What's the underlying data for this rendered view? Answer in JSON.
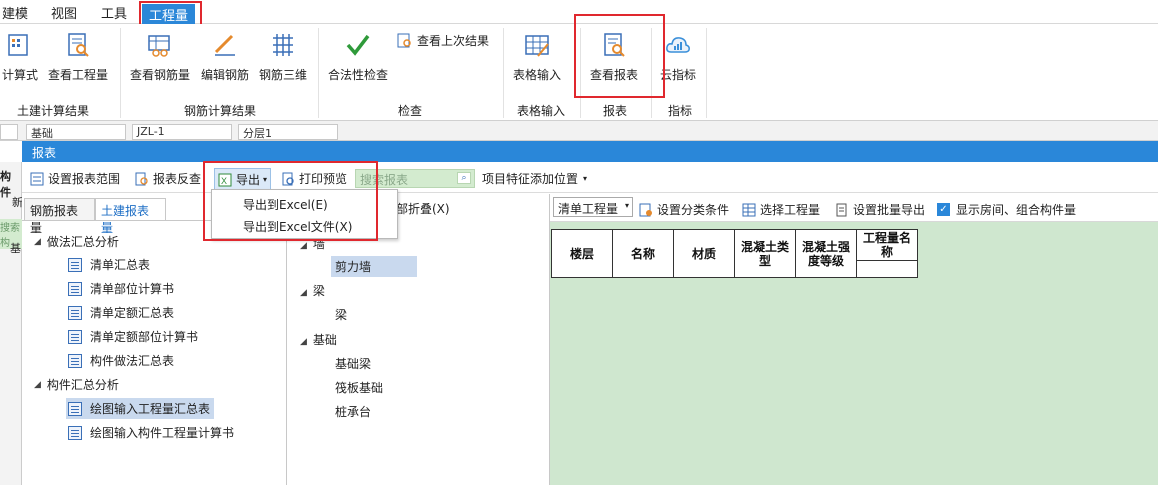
{
  "menubar": {
    "items": [
      "建模",
      "视图",
      "工具",
      "工程量"
    ]
  },
  "ribbon": {
    "buttons": [
      "计算式",
      "查看工程量",
      "查看钢筋量",
      "编辑钢筋",
      "钢筋三维",
      "合法性检查",
      "查看上次结果",
      "表格输入",
      "查看报表",
      "云指标"
    ],
    "groups": [
      "土建计算结果",
      "钢筋计算结果",
      "检查",
      "表格输入",
      "报表",
      "指标"
    ]
  },
  "combos": [
    "基础",
    "JZL-1",
    "分层1"
  ],
  "dialog": {
    "title": "报表",
    "toolbar": {
      "set_range": "设置报表范围",
      "reverse": "报表反查",
      "export": "导出",
      "print_preview": "打印预览",
      "search_placeholder": "搜索报表",
      "feature_position": "项目特征添加位置"
    },
    "export_menu": [
      "导出到Excel(E)",
      "导出到Excel文件(X)"
    ],
    "left_tabs": [
      "钢筋报表量",
      "土建报表量"
    ],
    "tree": {
      "group1": "做法汇总分析",
      "group1_items": [
        "清单汇总表",
        "清单部位计算书",
        "清单定额汇总表",
        "清单定额部位计算书",
        "构件做法汇总表"
      ],
      "group2": "构件汇总分析",
      "group2_items": [
        "绘图输入工程量汇总表",
        "绘图输入构件工程量计算书"
      ]
    },
    "middle": {
      "collapse_all": "部折叠(X)",
      "categories": [
        {
          "name": "墙",
          "items": [
            "剪力墙"
          ]
        },
        {
          "name": "梁",
          "items": [
            "梁"
          ]
        },
        {
          "name": "基础",
          "items": [
            "基础梁",
            "筏板基础",
            "桩承台"
          ]
        }
      ]
    },
    "right_toolbar": {
      "select": "清单工程量",
      "category_condition": "设置分类条件",
      "select_quantity": "选择工程量",
      "batch_export": "设置批量导出",
      "show_rooms": "显示房间、组合构件量"
    },
    "table_headers": [
      "楼层",
      "名称",
      "材质",
      "混凝土类型",
      "混凝土强度等级",
      "工程量名称"
    ]
  },
  "background": {
    "left_labels": [
      "构件",
      "新",
      "搜索构",
      "基"
    ]
  },
  "colors": {
    "accent": "#2a87d9",
    "highlight_box": "#e0282e",
    "report_bg": "#cfe7cf"
  }
}
